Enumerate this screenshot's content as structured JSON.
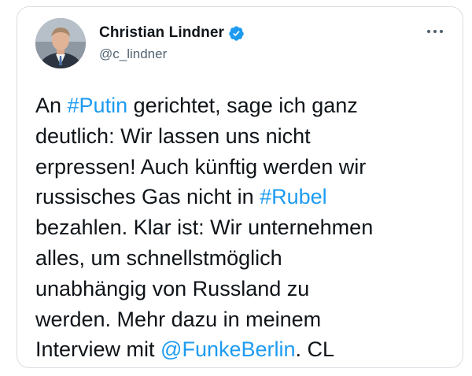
{
  "tweet": {
    "author": {
      "display_name": "Christian Lindner",
      "handle": "@c_lindner",
      "verified": true
    },
    "more_icon": "more-horizontal-icon",
    "text_segments": [
      {
        "text": "An ",
        "kind": "text"
      },
      {
        "text": "#Putin",
        "kind": "hashtag"
      },
      {
        "text": " gerichtet, sage ich ganz\ndeutlich: Wir lassen uns nicht\nerpressen! Auch künftig werden wir\nrussisches Gas nicht in ",
        "kind": "text"
      },
      {
        "text": "#Rubel",
        "kind": "hashtag"
      },
      {
        "text": "\nbezahlen. Klar ist: Wir unternehmen\nalles, um schnellstmöglich\nunabhängig von Russland zu\nwerden. Mehr dazu in meinem\nInterview mit ",
        "kind": "text"
      },
      {
        "text": "@FunkeBerlin",
        "kind": "mention"
      },
      {
        "text": ". CL",
        "kind": "text"
      }
    ]
  },
  "colors": {
    "text": "#0f1419",
    "secondary": "#536471",
    "link": "#1d9bf0",
    "verified": "#1d9bf0",
    "border": "#d9dde1"
  }
}
